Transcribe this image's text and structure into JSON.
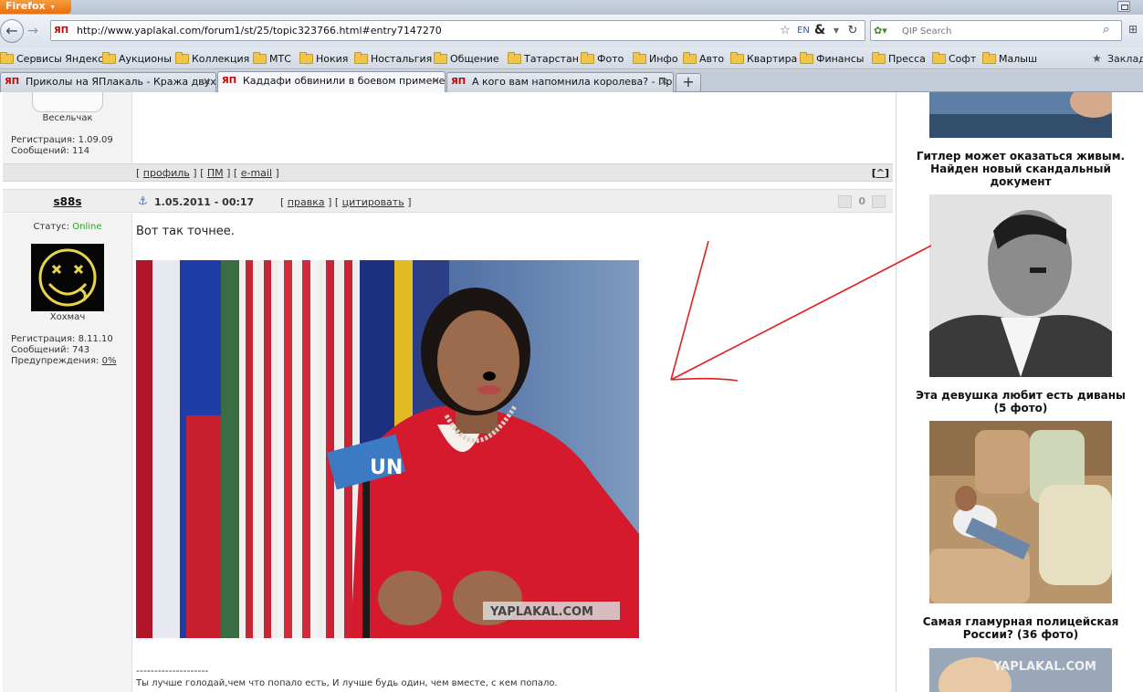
{
  "browser": {
    "app_button": "Firefox",
    "url": "http://www.yaplakal.com/forum1/st/25/topic323766.html#entry7147270",
    "site_icon_label": "ЯП",
    "lang_icon_label": "EN",
    "search_placeholder": "QIP Search",
    "icons": {
      "back": "back-arrow-icon",
      "forward": "forward-arrow-icon",
      "star": "star-icon",
      "reload": "reload-icon",
      "search": "magnifier-icon"
    }
  },
  "bookmarks": {
    "items": [
      "Сервисы Яндекса",
      "Аукционы",
      "Коллекция",
      "МТС",
      "Нокия",
      "Ностальгия",
      "Общение",
      "Татарстан",
      "Фото",
      "Инфо",
      "Авто",
      "Квартира",
      "Финансы",
      "Пресса",
      "Софт",
      "Малыш"
    ],
    "right_label": "Заклад"
  },
  "tabs": [
    {
      "label": "Приколы на ЯПлакаль - Кража двух я...",
      "active": false
    },
    {
      "label": "Каддафи обвинили в боевом применен...",
      "active": true
    },
    {
      "label": "А кого вам напомнила королева? - При...",
      "active": false
    }
  ],
  "prev_post": {
    "rank": "Весельчак",
    "registration": "Регистрация: 1.09.09",
    "messages": "Сообщений: 114",
    "actions": {
      "profile": "профиль",
      "pm": "ПМ",
      "email": "e-mail"
    },
    "top_button": "^"
  },
  "post": {
    "username": "s88s",
    "date": "1.05.2011 - 00:17",
    "actions": {
      "edit": "правка",
      "quote": "цитировать"
    },
    "rating": "0",
    "status_label": "Статус: ",
    "status_value": "Online",
    "rank": "Хохмач",
    "registration": "Регистрация: 8.11.10",
    "messages": "Сообщений: 743",
    "warnings_label": "Предупреждения: ",
    "warnings_value": "0%",
    "text": "Вот так точнее.",
    "image_watermark": "YAPLAKAL.COM",
    "image_mic_label": "UN",
    "signature_separator": "--------------------",
    "signature": "Ты лучше голодай,чем что попало есть, И лучше будь один, чем вместе, с кем попало."
  },
  "sidebar": {
    "captions": [
      "Гитлер может оказаться живым. Найден новый скандальный документ",
      "Эта девушка любит есть диваны (5 фото)",
      "Самая гламурная полицейская России? (36 фото)"
    ],
    "watermark": "YAPLAKAL.COM"
  },
  "colors": {
    "online": "#2ea02e",
    "annotation": "#e02020",
    "brand": "#cc0000"
  }
}
